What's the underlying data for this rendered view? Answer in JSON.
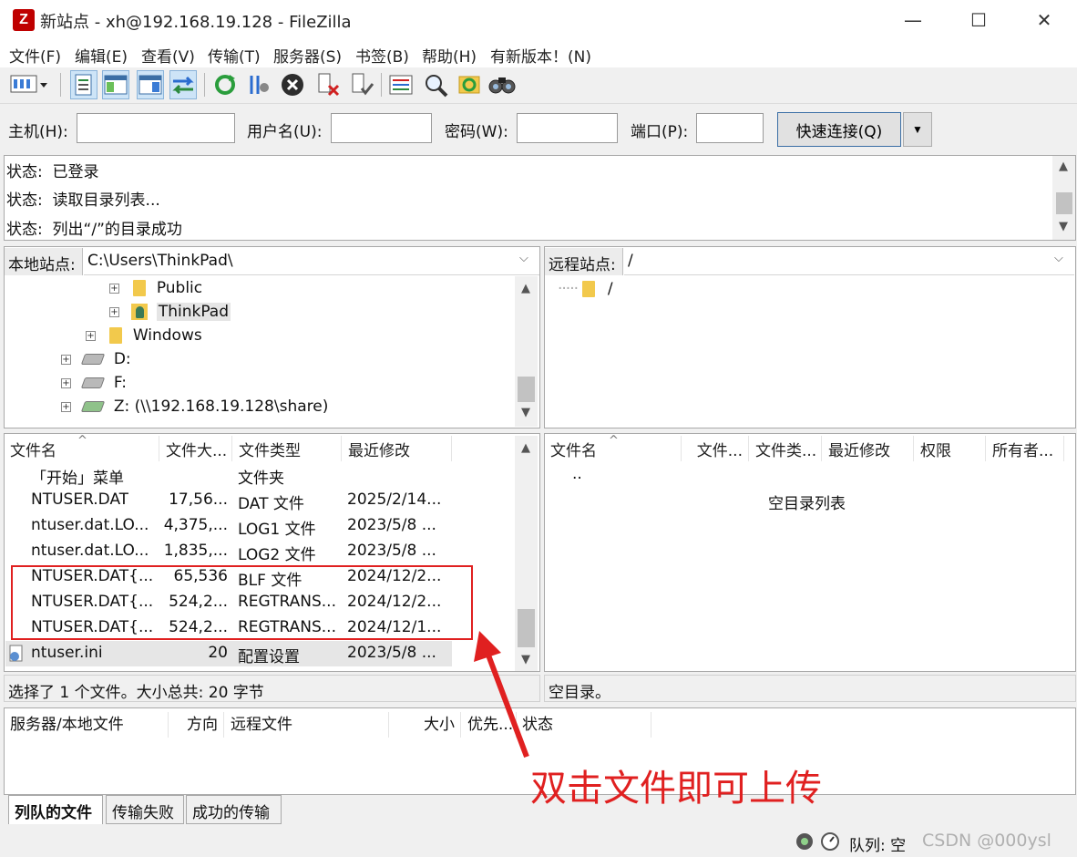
{
  "window": {
    "title": "新站点 - xh@192.168.19.128 - FileZilla",
    "app_icon": "Z",
    "minimize": "—",
    "maximize": "☐",
    "close": "✕"
  },
  "menu": [
    "文件(F)",
    "编辑(E)",
    "查看(V)",
    "传输(T)",
    "服务器(S)",
    "书签(B)",
    "帮助(H)",
    "有新版本！(N)"
  ],
  "quickconnect": {
    "host_label": "主机(H):",
    "user_label": "用户名(U):",
    "pass_label": "密码(W):",
    "port_label": "端口(P):",
    "host_value": "",
    "user_value": "",
    "pass_value": "",
    "port_value": "",
    "connect_button": "快速连接(Q)",
    "dropdown_arrow": "▼"
  },
  "log": [
    {
      "label": "状态:",
      "text": "已登录"
    },
    {
      "label": "状态:",
      "text": "读取目录列表..."
    },
    {
      "label": "状态:",
      "text": "列出“/”的目录成功"
    }
  ],
  "local": {
    "site_label": "本地站点:",
    "path": "C:\\Users\\ThinkPad\\",
    "tree": [
      {
        "name": "Public",
        "expander": "+",
        "icon": "folder-icon"
      },
      {
        "name": "ThinkPad",
        "expander": "+",
        "icon": "user-folder-icon"
      },
      {
        "name": "Windows",
        "expander": "+",
        "icon": "folder-icon"
      },
      {
        "name": "D:",
        "expander": "+",
        "icon": "drive-icon"
      },
      {
        "name": "F:",
        "expander": "+",
        "icon": "drive-icon"
      },
      {
        "name": "Z: (\\\\192.168.19.128\\share)",
        "expander": "+",
        "icon": "network-drive-icon"
      }
    ],
    "columns": [
      "文件名",
      "文件大...",
      "文件类型",
      "最近修改"
    ],
    "sort_indicator": "^",
    "files": [
      {
        "name": "「开始」菜单",
        "size": "",
        "type": "文件夹",
        "modified": "",
        "icon": "folder-icon"
      },
      {
        "name": "NTUSER.DAT",
        "size": "17,56...",
        "type": "DAT 文件",
        "modified": "2025/2/14...",
        "icon": "file-icon"
      },
      {
        "name": "ntuser.dat.LO...",
        "size": "4,375,...",
        "type": "LOG1 文件",
        "modified": "2023/5/8 ...",
        "icon": "file-icon"
      },
      {
        "name": "ntuser.dat.LO...",
        "size": "1,835,...",
        "type": "LOG2 文件",
        "modified": "2023/5/8 ...",
        "icon": "file-icon"
      },
      {
        "name": "NTUSER.DAT{...",
        "size": "65,536",
        "type": "BLF 文件",
        "modified": "2024/12/2...",
        "icon": "file-icon"
      },
      {
        "name": "NTUSER.DAT{...",
        "size": "524,2...",
        "type": "REGTRANS...",
        "modified": "2024/12/2...",
        "icon": "file-icon"
      },
      {
        "name": "NTUSER.DAT{...",
        "size": "524,2...",
        "type": "REGTRANS...",
        "modified": "2024/12/1...",
        "icon": "file-icon"
      },
      {
        "name": "ntuser.ini",
        "size": "20",
        "type": "配置设置",
        "modified": "2023/5/8 ...",
        "icon": "settings-file-icon"
      }
    ],
    "status": "选择了 1 个文件。大小总共: 20 字节"
  },
  "remote": {
    "site_label": "远程站点:",
    "path": "/",
    "tree": [
      {
        "name": "/",
        "icon": "folder-icon"
      }
    ],
    "columns": [
      "文件名",
      "文件...",
      "文件类...",
      "最近修改",
      "权限",
      "所有者..."
    ],
    "sort_indicator": "^",
    "parent_dir": "..",
    "empty_message": "空目录列表",
    "status": "空目录。"
  },
  "queue": {
    "columns": [
      "服务器/本地文件",
      "方向",
      "远程文件",
      "大小",
      "优先...",
      "状态"
    ],
    "tabs": [
      "列队的文件",
      "传输失败",
      "成功的传输"
    ],
    "status_text": "队列: 空"
  },
  "annotation": {
    "text": "双击文件即可上传",
    "color": "#e02020"
  },
  "watermark": "CSDN @000ysl"
}
